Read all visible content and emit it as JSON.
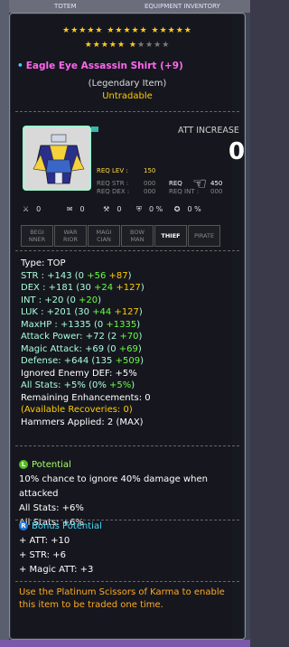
{
  "background": {
    "tab_left": "TOTEM",
    "tab_right": "EQUIPMENT INVENTORY"
  },
  "stars": {
    "row1": "★★★★★ ★★★★★ ★★★★★",
    "row2_on": "★★★★★ ★",
    "row2_off": "★★★★"
  },
  "item": {
    "name": "Eagle Eye Assassin Shirt (+9)",
    "rarity": "(Legendary Item)",
    "trade": "Untradable"
  },
  "requirements": {
    "lev_label": "REQ LEV :",
    "lev_value": "150",
    "str_label": "REQ STR :",
    "str_value": "000",
    "dex_label": "REQ DEX :",
    "dex_value": "000",
    "luk_label": "REQ",
    "luk_value": "450",
    "int_label": "REQ INT :",
    "int_value": "000"
  },
  "att_increase": {
    "label": "ATT INCREASE",
    "value": "0"
  },
  "mini_icons": [
    "0",
    "0",
    "0",
    "0 %",
    "0 %"
  ],
  "classes": [
    {
      "label": "BEGI\nNNER",
      "active": false
    },
    {
      "label": "WAR\nRIOR",
      "active": false
    },
    {
      "label": "MAGI\nCIAN",
      "active": false
    },
    {
      "label": "BOW\nMAN",
      "active": false
    },
    {
      "label": "THIEF",
      "active": true
    },
    {
      "label": "PIRATE",
      "active": false
    }
  ],
  "stats": {
    "type": "Type: TOP",
    "str": {
      "label": "STR : +143 (0 ",
      "a": "+56",
      "b": "+87",
      "end": ")"
    },
    "dex": {
      "label": "DEX : +181 (30 ",
      "a": "+24",
      "b": "+127",
      "end": ")"
    },
    "int": {
      "label": "INT : +20 (0 ",
      "a": "+20",
      "end": ")"
    },
    "luk": {
      "label": "LUK : +201 (30 ",
      "a": "+44",
      "b": "+127",
      "end": ")"
    },
    "maxhp": {
      "label": "MaxHP : +1335 (0 ",
      "a": "+1335",
      "end": ")"
    },
    "attack": {
      "label": "Attack Power: +72 (2 ",
      "a": "+70",
      "end": ")"
    },
    "magic": {
      "label": "Magic Attack: +69 (0 ",
      "a": "+69",
      "end": ")"
    },
    "defense": {
      "label": "Defense: +644 (135 ",
      "a": "+509",
      "end": ")"
    },
    "ied": "Ignored Enemy DEF: +5%",
    "allstats": {
      "label": "All Stats: +5% ",
      "a": "(0% ",
      "b": "+5%",
      "end": ")"
    },
    "remaining": "Remaining Enhancements: 0",
    "recoveries": "(Available Recoveries: 0)",
    "hammers": "Hammers Applied: 2 (MAX)"
  },
  "potential": {
    "title": "Potential",
    "lines": [
      "10% chance to ignore 40% damage when attacked",
      "All Stats: +6%",
      "All Stats: +6%"
    ]
  },
  "bonus_potential": {
    "title": "Bonus Potential",
    "lines": [
      "+ ATT: +10",
      "+ STR: +6",
      "+ Magic ATT: +3"
    ]
  },
  "footer": "Use the Platinum Scissors of Karma to enable this item to be traded one time.",
  "colors": {
    "name": "#ff66ee",
    "rarity_note": "#ffcc00",
    "green": "#66ff44",
    "potential": "#a8ff6a",
    "bonus": "#44ddff",
    "footer": "#ffaa22"
  }
}
